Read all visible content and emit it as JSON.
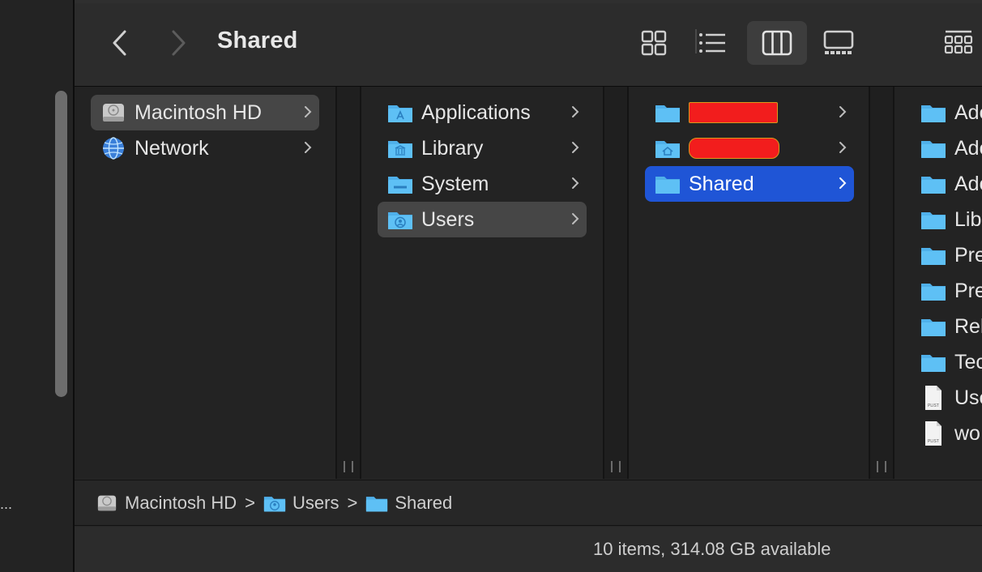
{
  "window": {
    "title": "Shared"
  },
  "sidebar": {
    "items": [
      {
        "label": "Macintosh HD",
        "icon": "hard-drive-icon"
      },
      {
        "label": "Network",
        "icon": "network-globe-icon"
      }
    ]
  },
  "columns": {
    "root": [
      {
        "label": "Applications",
        "icon": "applications-folder-icon"
      },
      {
        "label": "Library",
        "icon": "library-folder-icon"
      },
      {
        "label": "System",
        "icon": "system-folder-icon"
      },
      {
        "label": "Users",
        "icon": "users-folder-icon"
      }
    ],
    "users": [
      {
        "label": "",
        "icon": "folder-icon",
        "redacted": true
      },
      {
        "label": "",
        "icon": "home-folder-icon",
        "redacted": true
      },
      {
        "label": "Shared",
        "icon": "folder-icon"
      }
    ],
    "shared": [
      {
        "label": "Ado",
        "icon": "folder-icon"
      },
      {
        "label": "Ado",
        "icon": "folder-icon"
      },
      {
        "label": "Ado",
        "icon": "folder-icon"
      },
      {
        "label": "Libr",
        "icon": "folder-icon"
      },
      {
        "label": "Pre",
        "icon": "folder-icon"
      },
      {
        "label": "Pre",
        "icon": "folder-icon"
      },
      {
        "label": "Rel",
        "icon": "folder-icon"
      },
      {
        "label": "Tec",
        "icon": "folder-icon"
      },
      {
        "label": "Use",
        "icon": "plist-file-icon"
      },
      {
        "label": "wo",
        "icon": "plist-file-icon"
      }
    ]
  },
  "pathbar": {
    "items": [
      {
        "label": "Macintosh HD",
        "icon": "hard-drive-icon"
      },
      {
        "label": "Users",
        "icon": "users-folder-icon"
      },
      {
        "label": "Shared",
        "icon": "folder-icon"
      }
    ],
    "separator": ">"
  },
  "status": {
    "text": "10 items, 314.08 GB available"
  },
  "left_pane": {
    "ellipsis": "..."
  },
  "colors": {
    "folder": "#4fb0ea",
    "selection_blue": "#1f55d6",
    "selection_gray": "#464646",
    "redaction": "#f21d1d"
  }
}
